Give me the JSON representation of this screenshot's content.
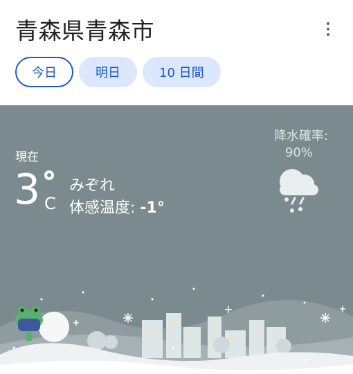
{
  "header": {
    "title": "青森県青森市",
    "menu_icon": "more-vert-icon"
  },
  "tabs": [
    {
      "label": "今日",
      "active": true
    },
    {
      "label": "明日",
      "active": false
    },
    {
      "label": "10 日間",
      "active": false
    }
  ],
  "weather": {
    "current_label": "現在",
    "temperature": "3",
    "unit": "C",
    "condition": "みぞれ",
    "feels_like_label": "体感温度: ",
    "feels_like_value": "-1°",
    "precip_label": "降水確率:",
    "precip_value": "90%",
    "icon": "sleet-icon"
  },
  "colors": {
    "accent": "#1a57c9",
    "tab_bg": "#dbe7fb",
    "weather_bg": "#7b8a8f",
    "precip_text": "#d7ebe2"
  }
}
